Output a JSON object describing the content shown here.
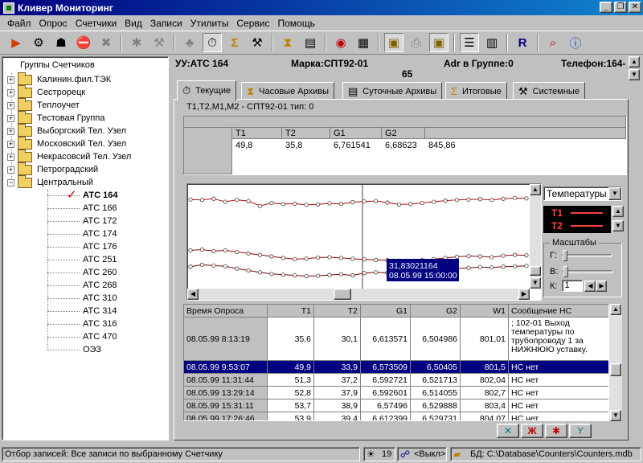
{
  "window": {
    "title": "Кливер Мониторинг"
  },
  "menu": [
    "Файл",
    "Опрос",
    "Счетчики",
    "Вид",
    "Записи",
    "Утилиты",
    "Сервис",
    "Помощь"
  ],
  "tree": {
    "root": "Группы Счетчиков",
    "groups": [
      "Калинин.фил.ТЭК",
      "Сестрорецк",
      "Теплоучет",
      "Тестовая Группа",
      "Выборгский Тел. Узел",
      "Московский Тел. Узел",
      "Некрасовсий Тел. Узел",
      "Петроградский",
      "Центральный"
    ],
    "leaves": [
      "АТС 164",
      "АТС 166",
      "АТС 172",
      "АТС 174",
      "АТС 176",
      "АТС 251",
      "АТС 260",
      "АТС 268",
      "АТС 310",
      "АТС 314",
      "АТС 316",
      "АТС 470",
      "ОЭЗ"
    ]
  },
  "info": {
    "uu": "УУ:АТС 164",
    "brand": "Марка:СПТ92-01",
    "adr": "Adr в Группе:0",
    "phone": "Телефон:164-",
    "num": "65"
  },
  "tabs": [
    "Текущие",
    "Часовые Архивы",
    "Суточные Архивы",
    "Итоговые",
    "Системные"
  ],
  "device_line": "T1,T2,M1,M2 - СПТ92-01 тип: 0",
  "current": {
    "headers": [
      "T1",
      "T2",
      "G1",
      "G2"
    ],
    "values": [
      "49,8",
      "35,8",
      "6,761541",
      "6,68623",
      "845,86"
    ]
  },
  "chart": {
    "tooltip_value": "31,83021164",
    "tooltip_time": "08.05.99 15:00:00"
  },
  "chart_data": {
    "type": "line",
    "series": [
      {
        "name": "T1",
        "values": [
          50.2,
          50.1,
          50.4,
          49.6,
          50.1,
          49.8,
          48.5,
          49.3,
          49.0,
          49.1,
          48.8,
          48.9,
          49.2,
          49.0,
          49.5,
          49.7,
          49.8,
          49.4,
          48.9,
          49.0,
          49.3,
          49.6,
          49.9,
          50.1,
          50.2,
          50.3,
          50.1,
          50.4,
          50.6,
          50.5
        ]
      },
      {
        "name": "T2",
        "values": [
          36.8,
          37.0,
          36.6,
          36.8,
          36.4,
          36.0,
          35.6,
          35.2,
          34.8,
          34.5,
          34.6,
          34.9,
          35.0,
          34.8,
          34.6,
          34.4,
          34.3,
          34.2,
          34.1,
          34.0,
          34.2,
          34.5,
          34.8,
          35.1,
          35.3,
          35.2,
          35.0,
          35.4,
          35.6,
          35.5
        ]
      },
      {
        "name": "",
        "values": [
          32.5,
          33.0,
          32.8,
          32.6,
          32.0,
          31.5,
          31.0,
          30.6,
          30.4,
          30.2,
          30.0,
          30.1,
          30.3,
          30.5,
          30.2,
          30.8,
          31.0,
          30.9,
          31.1,
          31.4,
          31.6,
          31.8,
          31.9,
          32.0,
          32.2,
          32.4,
          32.3,
          32.5,
          32.6,
          32.7
        ]
      }
    ],
    "grid": false
  },
  "right_panel": {
    "select": "Температуры",
    "legend": [
      "T1",
      "T2"
    ],
    "scales_title": "Масштабы",
    "scale_labels": [
      "Г:",
      "В:",
      "К:"
    ],
    "k_value": "1"
  },
  "grid": {
    "headers": [
      "Время Опроса",
      "T1",
      "T2",
      "G1",
      "G2",
      "W1",
      "Сообщение НС"
    ],
    "rows": [
      [
        "08.05.99 8:13:19",
        "35,6",
        "30,1",
        "6,613571",
        "6,504986",
        "801,01",
        "; 102-01   Выход температуры по трубопроводу 1 за НИЖНЮЮ уставку."
      ],
      [
        "08.05.99 9:53:07",
        "49,9",
        "33,9",
        "6,573509",
        "6,50405",
        "801,5",
        "НС нет"
      ],
      [
        "08.05.99 11:31:44",
        "51,3",
        "37,2",
        "6,592721",
        "6,521713",
        "802,04",
        "НС нет"
      ],
      [
        "08.05.99 13:29:14",
        "52,8",
        "37,9",
        "6,592601",
        "6,514055",
        "802,7",
        "НС нет"
      ],
      [
        "08.05.99 15:31:11",
        "53,7",
        "38,9",
        "6,57496",
        "6,529888",
        "803,4",
        "НС нет"
      ],
      [
        "08.05.99 17:26:46",
        "53,9",
        "39,4",
        "6,612399",
        "6,529731",
        "804,07",
        "НС нет"
      ]
    ]
  },
  "status": {
    "filter": "Отбор записей: Все записи по выбранному Счетчику",
    "count": "19",
    "mode": "<Выкл>",
    "db": "БД: C:\\Database\\Counters\\Counters.mdb"
  },
  "colors": {
    "title": "#000080",
    "selection": "#000080",
    "chart_line": "#c00000"
  }
}
